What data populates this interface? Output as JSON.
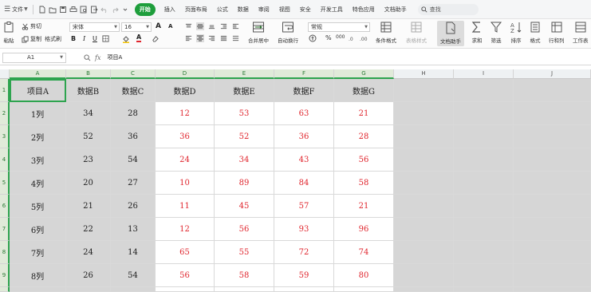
{
  "menubar": {
    "file_label": "文件",
    "tabs": [
      "开始",
      "插入",
      "页面布局",
      "公式",
      "数据",
      "审阅",
      "视图",
      "安全",
      "开发工具",
      "特色应用",
      "文档助手"
    ],
    "search_label": "查找"
  },
  "ribbon": {
    "paste": "粘贴",
    "cut": "剪切",
    "copy": "复制",
    "format_painter": "格式刷",
    "font_name": "宋体",
    "font_size": "16",
    "align_merge": "合并居中",
    "wrap_text": "自动换行",
    "number_format": "常规",
    "cond_format": "条件格式",
    "table_style": "表格样式",
    "doc_helper": "文档助手",
    "sum": "求和",
    "filter": "筛选",
    "sort": "排序",
    "format": "格式",
    "rows_cols": "行和列",
    "worksheet": "工作表",
    "pct": "%",
    "thousands": "000",
    "fx": "fx",
    "bold": "B",
    "italic": "I",
    "underline": "U",
    "font_color": "A",
    "grow": "A",
    "shrink": "A"
  },
  "formula_bar": {
    "name_box": "A1",
    "content": "项目A"
  },
  "grid": {
    "columns": [
      "A",
      "B",
      "C",
      "D",
      "E",
      "F",
      "G",
      "H",
      "I",
      "J"
    ],
    "rows": [
      "1",
      "2",
      "3",
      "4",
      "5",
      "6",
      "7",
      "8",
      "9"
    ],
    "header": [
      "项目A",
      "数据B",
      "数据C",
      "数据D",
      "数据E",
      "数据F",
      "数据G"
    ],
    "data": [
      [
        "1列",
        "34",
        "28",
        "12",
        "53",
        "63",
        "21"
      ],
      [
        "2列",
        "52",
        "36",
        "36",
        "52",
        "36",
        "28"
      ],
      [
        "3列",
        "23",
        "54",
        "24",
        "34",
        "43",
        "56"
      ],
      [
        "4列",
        "20",
        "27",
        "10",
        "89",
        "84",
        "58"
      ],
      [
        "5列",
        "21",
        "26",
        "11",
        "45",
        "57",
        "21"
      ],
      [
        "6列",
        "22",
        "13",
        "12",
        "56",
        "93",
        "96"
      ],
      [
        "7列",
        "24",
        "14",
        "65",
        "55",
        "72",
        "74"
      ],
      [
        "8列",
        "26",
        "54",
        "56",
        "58",
        "59",
        "80"
      ]
    ]
  },
  "colors": {
    "accent": "#1e9e3c",
    "red_text": "#e0262e",
    "cell_gray": "#d6d6d6"
  }
}
